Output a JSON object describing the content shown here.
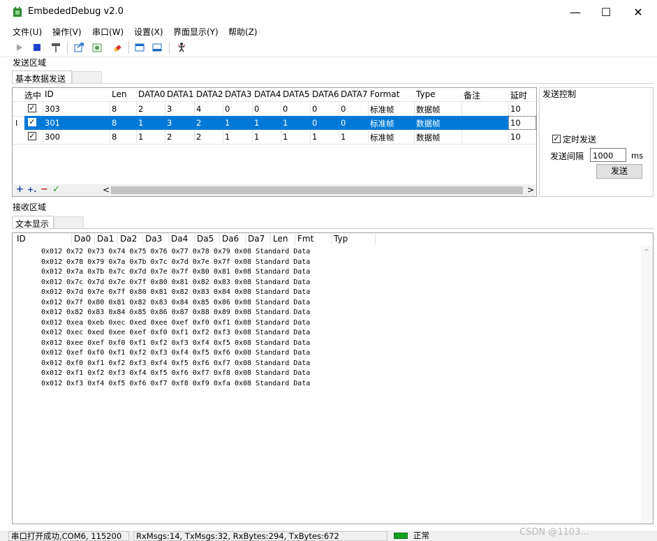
{
  "window": {
    "title": "EmbededDebug v2.0",
    "controls": [
      "—",
      "☐",
      "✕"
    ]
  },
  "menu": [
    "文件(U)",
    "操作(V)",
    "串口(W)",
    "设置(X)",
    "界面显示(Y)",
    "帮助(Z)"
  ],
  "toolbar": {
    "icons": [
      "play-icon",
      "stop-icon",
      "hammer-icon",
      "export-icon",
      "filter-icon",
      "eraser-icon",
      "window-icon",
      "window-bottom-icon",
      "dance-icon"
    ]
  },
  "send_area": {
    "title": "发送区域",
    "tab_active": "基本数据发送",
    "columns": [
      "选中",
      "ID",
      "Len",
      "DATA0",
      "DATA1",
      "DATA2",
      "DATA3",
      "DATA4",
      "DATA5",
      "DATA6",
      "DATA7",
      "Format",
      "Type",
      "备注",
      "延时"
    ],
    "rows": [
      {
        "checked": true,
        "selected": false,
        "cells": [
          "303",
          "8",
          "2",
          "3",
          "4",
          "0",
          "0",
          "0",
          "0",
          "0",
          "标准帧",
          "数据帧",
          "",
          "10"
        ]
      },
      {
        "checked": true,
        "selected": true,
        "cells": [
          "301",
          "8",
          "1",
          "3",
          "2",
          "1",
          "1",
          "1",
          "0",
          "0",
          "标准帧",
          "数据帧",
          "",
          "10"
        ]
      },
      {
        "checked": true,
        "selected": false,
        "cells": [
          "300",
          "8",
          "1",
          "2",
          "2",
          "1",
          "1",
          "1",
          "1",
          "1",
          "标准帧",
          "数据帧",
          "",
          "10"
        ]
      }
    ],
    "row_cursor": "I",
    "bottom_buttons": [
      "+",
      "+.",
      "−",
      "✓"
    ],
    "scroll_left": "<",
    "scroll_right": ">"
  },
  "send_control": {
    "title": "发送控制",
    "timed_send_label": "定时发送",
    "timed_send_checked": true,
    "interval_label": "发送间隔",
    "interval_value": "1000",
    "interval_unit": "ms",
    "send_button": "发送"
  },
  "recv_area": {
    "title": "接收区域",
    "tab_active": "文本显示",
    "columns": [
      "ID",
      "Da0",
      "Da1",
      "Da2",
      "Da3",
      "Da4",
      "Da5",
      "Da6",
      "Da7",
      "Len",
      "Fmt",
      "Typ"
    ],
    "lines": [
      "0x012 0x72 0x73 0x74 0x75 0x76 0x77 0x78 0x79 0x08 Standard Data",
      "0x012 0x78 0x79 0x7a 0x7b 0x7c 0x7d 0x7e 0x7f 0x08 Standard Data",
      "0x012 0x7a 0x7b 0x7c 0x7d 0x7e 0x7f 0x80 0x81 0x08 Standard Data",
      "0x012 0x7c 0x7d 0x7e 0x7f 0x80 0x81 0x82 0x83 0x08 Standard Data",
      "0x012 0x7d 0x7e 0x7f 0x80 0x81 0x82 0x83 0x84 0x08 Standard Data",
      "0x012 0x7f 0x80 0x81 0x82 0x83 0x84 0x85 0x86 0x08 Standard Data",
      "0x012 0x82 0x83 0x84 0x85 0x86 0x87 0x88 0x89 0x08 Standard Data",
      "0x012 0xea 0xeb 0xec 0xed 0xee 0xef 0xf0 0xf1 0x08 Standard Data",
      "0x012 0xec 0xed 0xee 0xef 0xf0 0xf1 0xf2 0xf3 0x08 Standard Data",
      "0x012 0xee 0xef 0xf0 0xf1 0xf2 0xf3 0xf4 0xf5 0x08 Standard Data",
      "0x012 0xef 0xf0 0xf1 0xf2 0xf3 0xf4 0xf5 0xf6 0x08 Standard Data",
      "0x012 0xf0 0xf1 0xf2 0xf3 0xf4 0xf5 0xf6 0xf7 0x08 Standard Data",
      "0x012 0xf1 0xf2 0xf3 0xf4 0xf5 0xf6 0xf7 0xf8 0x08 Standard Data",
      "0x012 0xf3 0xf4 0xf5 0xf6 0xf7 0xf8 0xf9 0xfa 0x08 Standard Data"
    ],
    "scroll_up": "^"
  },
  "statusbar": {
    "port": "串口打开成功,COM6, 115200",
    "stats": "RxMsgs:14, TxMsgs:32, RxBytes:294, TxBytes:672",
    "state": "正常",
    "watermark": "CSDN @1103…"
  },
  "colors": {
    "selection": "#0078d7",
    "indicator": "#14a01e"
  }
}
